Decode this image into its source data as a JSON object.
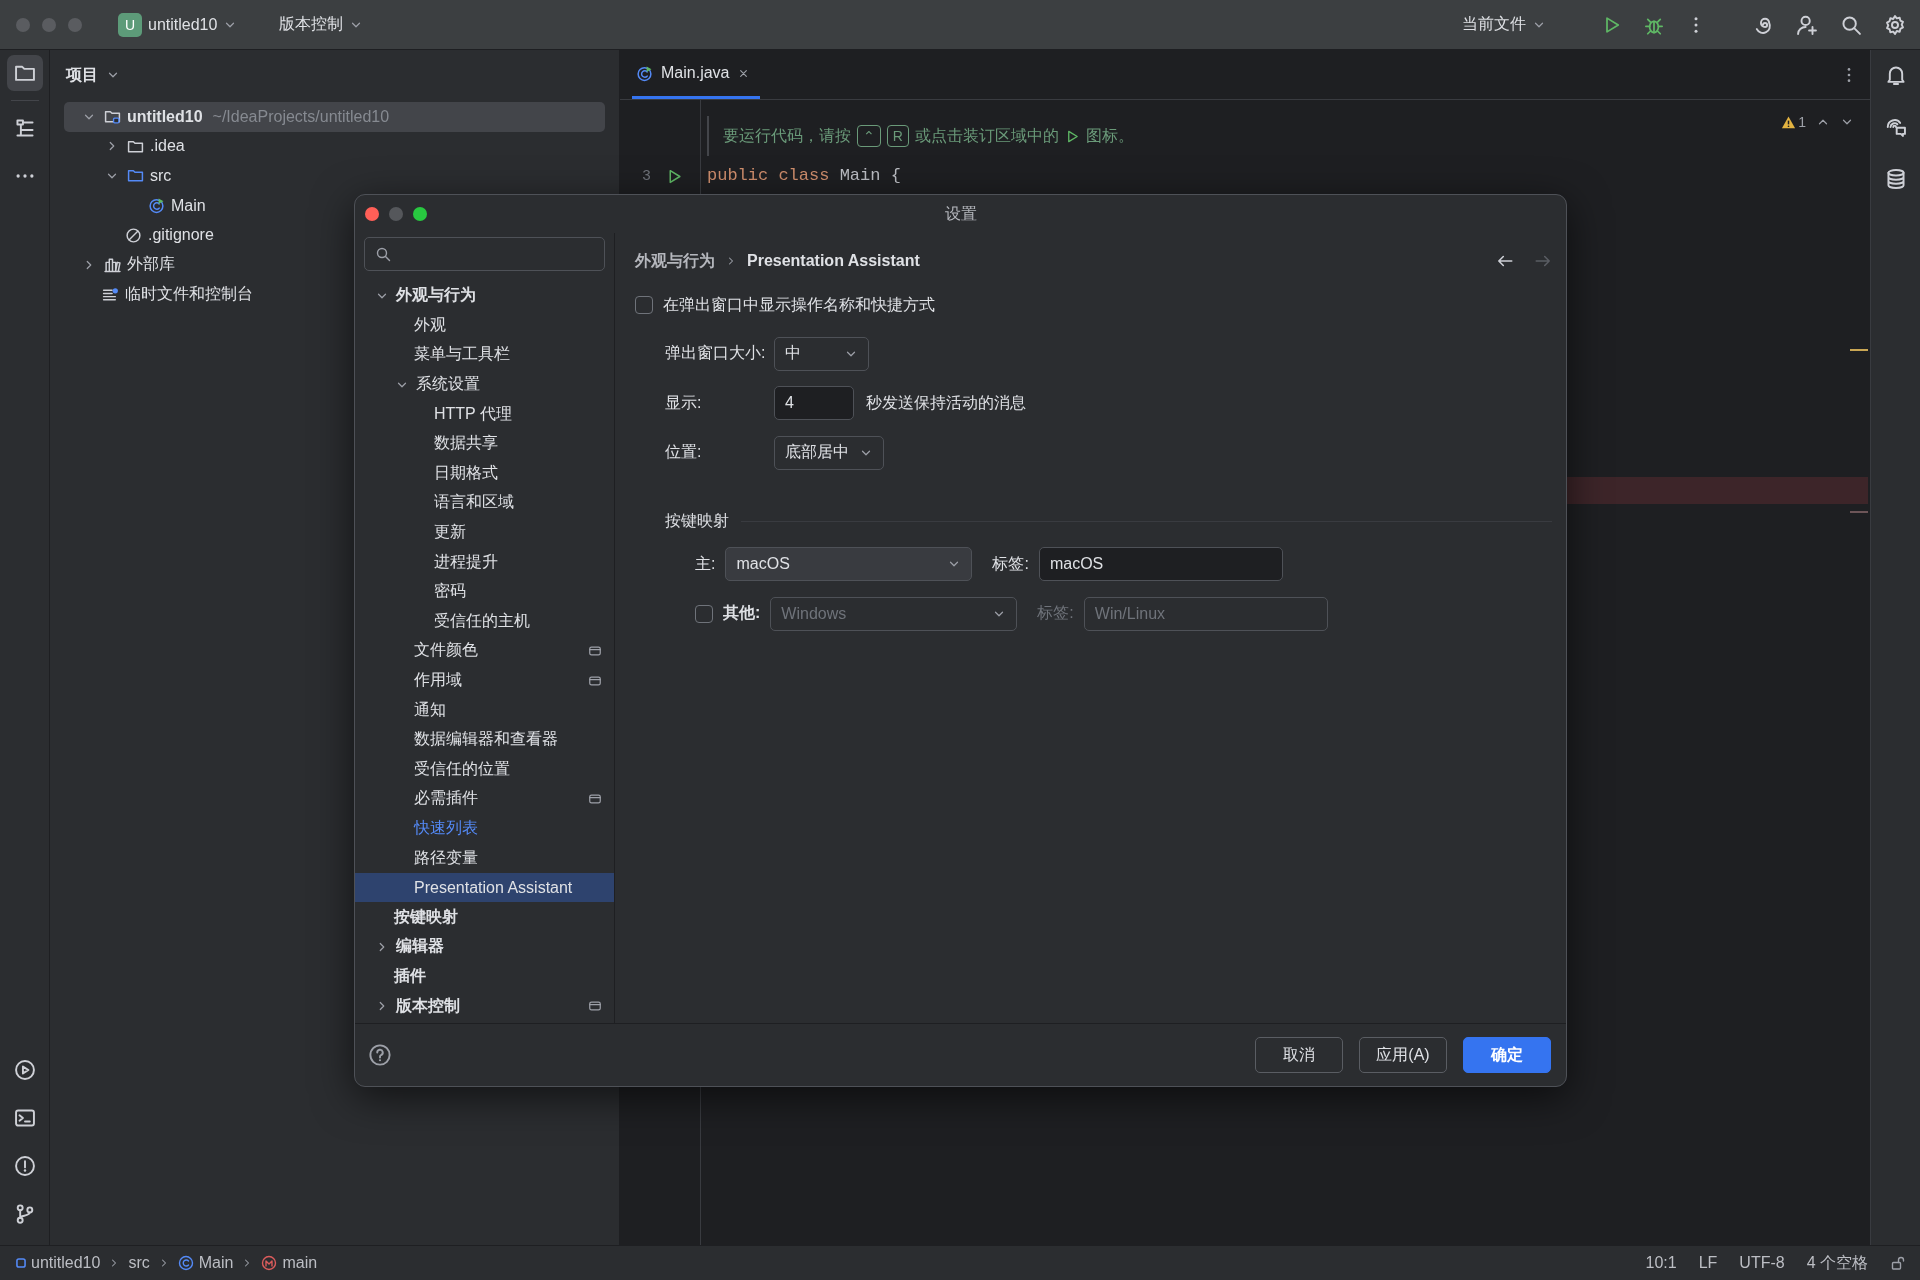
{
  "title_bar": {
    "project_badge": "U",
    "project": "untitled10",
    "vcs": "版本控制",
    "run_config": "当前文件"
  },
  "project_panel": {
    "title": "项目",
    "tree": [
      {
        "kind": "module",
        "name": "untitled10",
        "path": "~/IdeaProjects/untitled10",
        "selected": true,
        "expanded": true,
        "children": [
          {
            "kind": "folder",
            "name": ".idea",
            "selected": false,
            "expanded": false
          },
          {
            "kind": "source-folder",
            "name": "src",
            "selected": false,
            "expanded": true,
            "children": [
              {
                "kind": "class",
                "name": "Main",
                "selected": false
              }
            ]
          },
          {
            "kind": "ignore-file",
            "name": ".gitignore",
            "selected": false
          }
        ]
      },
      {
        "kind": "library",
        "name": "外部库",
        "selected": false,
        "expanded": false
      },
      {
        "kind": "scratch",
        "name": "临时文件和控制台",
        "selected": false
      }
    ]
  },
  "editor": {
    "tabs": [
      {
        "label": "Main.java",
        "selected": true
      }
    ],
    "warnings": "1",
    "hint": {
      "before": "要运行代码，请按",
      "keys": [
        "⌃",
        "R"
      ],
      "middle": "或点击装订区域中的",
      "after": "图标。"
    },
    "lines": [
      {
        "number": "3",
        "tokens": [
          {
            "kind": "keyword",
            "text": "public"
          },
          {
            "kind": "keyword",
            "text": "class"
          },
          {
            "kind": "plain",
            "text": "Main {"
          }
        ]
      }
    ]
  },
  "settings_dialog": {
    "title": "设置",
    "nav": [
      {
        "label": "外观与行为",
        "selected": false,
        "modified": false,
        "project_level": false,
        "expanded": true,
        "children": [
          {
            "label": "外观",
            "selected": false,
            "modified": false,
            "project_level": false
          },
          {
            "label": "菜单与工具栏",
            "selected": false,
            "modified": false,
            "project_level": false
          },
          {
            "label": "系统设置",
            "selected": false,
            "modified": false,
            "project_level": false,
            "expanded": true,
            "children": [
              {
                "label": "HTTP 代理",
                "selected": false,
                "modified": false,
                "project_level": false
              },
              {
                "label": "数据共享",
                "selected": false,
                "modified": false,
                "project_level": false
              },
              {
                "label": "日期格式",
                "selected": false,
                "modified": false,
                "project_level": false
              },
              {
                "label": "语言和区域",
                "selected": false,
                "modified": false,
                "project_level": false
              },
              {
                "label": "更新",
                "selected": false,
                "modified": false,
                "project_level": false
              },
              {
                "label": "进程提升",
                "selected": false,
                "modified": false,
                "project_level": false
              },
              {
                "label": "密码",
                "selected": false,
                "modified": false,
                "project_level": false
              },
              {
                "label": "受信任的主机",
                "selected": false,
                "modified": false,
                "project_level": false
              }
            ]
          },
          {
            "label": "文件颜色",
            "selected": false,
            "modified": false,
            "project_level": true
          },
          {
            "label": "作用域",
            "selected": false,
            "modified": false,
            "project_level": true
          },
          {
            "label": "通知",
            "selected": false,
            "modified": false,
            "project_level": false
          },
          {
            "label": "数据编辑器和查看器",
            "selected": false,
            "modified": false,
            "project_level": false
          },
          {
            "label": "受信任的位置",
            "selected": false,
            "modified": false,
            "project_level": false
          },
          {
            "label": "必需插件",
            "selected": false,
            "modified": false,
            "project_level": true
          },
          {
            "label": "快速列表",
            "selected": false,
            "modified": true,
            "project_level": false
          },
          {
            "label": "路径变量",
            "selected": false,
            "modified": false,
            "project_level": false
          },
          {
            "label": "Presentation Assistant",
            "selected": true,
            "modified": false,
            "project_level": false
          }
        ]
      },
      {
        "label": "按键映射",
        "selected": false,
        "modified": false,
        "project_level": false
      },
      {
        "label": "编辑器",
        "selected": false,
        "modified": false,
        "project_level": false,
        "expanded": false
      },
      {
        "label": "插件",
        "selected": false,
        "modified": false,
        "project_level": false
      },
      {
        "label": "版本控制",
        "selected": false,
        "modified": false,
        "project_level": true,
        "expanded": false
      }
    ],
    "breadcrumb": [
      "外观与行为",
      "Presentation Assistant"
    ],
    "nav_buttons": [
      {
        "kind": "back",
        "disabled": false
      },
      {
        "kind": "forward",
        "disabled": true
      }
    ],
    "show_popup": {
      "label": "在弹出窗口中显示操作名称和快捷方式",
      "checked": false
    },
    "options": [
      {
        "kind": "dropdown",
        "label": "弹出窗口大小:",
        "value": "中"
      },
      {
        "kind": "number",
        "label": "显示:",
        "value": "4",
        "suffix": "秒发送保持活动的消息"
      },
      {
        "kind": "dropdown",
        "label": "位置:",
        "value": "底部居中"
      }
    ],
    "keymap": {
      "title": "按键映射",
      "rows": [
        {
          "kind": "main",
          "label": "主:",
          "value": "macOS",
          "tag_label": "标签:",
          "tag_value": "macOS",
          "disabled": false
        },
        {
          "kind": "other",
          "label": "其他:",
          "checked": false,
          "value": "Windows",
          "tag_label": "标签:",
          "tag_value": "Win/Linux",
          "disabled": true
        }
      ]
    },
    "buttons": [
      {
        "label": "取消",
        "primary": false
      },
      {
        "label": "应用(A)",
        "primary": false
      },
      {
        "label": "确定",
        "primary": true
      }
    ]
  },
  "status_bar": {
    "breadcrumbs": [
      {
        "kind": "module",
        "label": "untitled10"
      },
      {
        "kind": "folder",
        "label": "src"
      },
      {
        "kind": "class",
        "label": "Main"
      },
      {
        "kind": "method",
        "label": "main"
      }
    ],
    "items": [
      "10:1",
      "LF",
      "UTF-8",
      "4 个空格"
    ]
  }
}
